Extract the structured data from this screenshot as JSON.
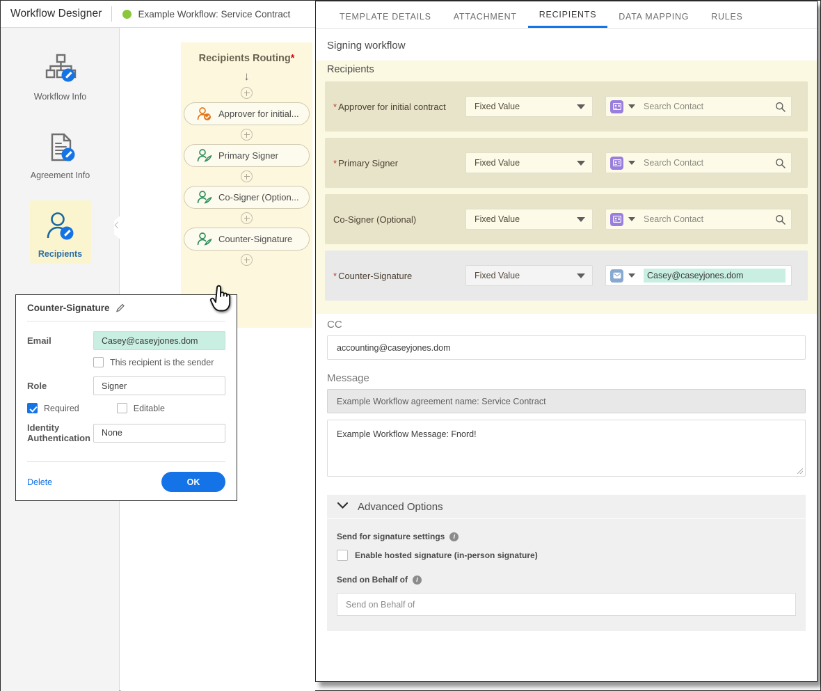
{
  "topbar": {
    "app_title": "Workflow Designer",
    "workflow_name": "Example Workflow: Service Contract",
    "status_color": "#8cc63e"
  },
  "sidebar": {
    "items": [
      {
        "label": "Workflow Info",
        "icon": "workflow-info-icon",
        "active": false
      },
      {
        "label": "Agreement Info",
        "icon": "agreement-info-icon",
        "active": false
      },
      {
        "label": "Recipients",
        "icon": "recipients-icon",
        "active": true
      },
      {
        "label": "",
        "icon": "documents-icon",
        "active": false
      }
    ]
  },
  "canvas": {
    "routing_title": "Recipients Routing",
    "routing_required_marker": "*",
    "nodes": [
      {
        "label": "Approver for initial...",
        "icon": "approver-icon",
        "color": "#e2761b"
      },
      {
        "label": "Primary Signer",
        "icon": "signer-icon",
        "color": "#2f8f5b"
      },
      {
        "label": "Co-Signer (Option...",
        "icon": "signer-icon",
        "color": "#2f8f5b"
      },
      {
        "label": "Counter-Signature",
        "icon": "signer-icon",
        "color": "#2f8f5b"
      }
    ]
  },
  "popup": {
    "title": "Counter-Signature",
    "edit_icon": "pencil-icon",
    "email_label": "Email",
    "email_value": "Casey@caseyjones.dom",
    "sender_checkbox_label": "This recipient is the sender",
    "sender_checked": false,
    "role_label": "Role",
    "role_value": "Signer",
    "required_label": "Required",
    "required_checked": true,
    "editable_label": "Editable",
    "editable_checked": false,
    "identity_label": "Identity Authentication",
    "identity_value": "None",
    "delete_label": "Delete",
    "ok_label": "OK",
    "accent_color": "#1473e6"
  },
  "right_panel": {
    "tabs": [
      {
        "label": "TEMPLATE DETAILS",
        "active": false
      },
      {
        "label": "ATTACHMENT",
        "active": false
      },
      {
        "label": "RECIPIENTS",
        "active": true
      },
      {
        "label": "DATA MAPPING",
        "active": false
      },
      {
        "label": "RULES",
        "active": false
      }
    ],
    "signing_workflow_label": "Signing workflow",
    "recipients_header": "Recipients",
    "recipient_rows": [
      {
        "label": "Approver for initial contract",
        "required": true,
        "value_type": "Fixed Value",
        "contact_icon": "contact-card-icon",
        "contact_placeholder": "Search Contact",
        "contact_value": "",
        "style": "khaki"
      },
      {
        "label": "Primary Signer",
        "required": true,
        "value_type": "Fixed Value",
        "contact_icon": "contact-card-icon",
        "contact_placeholder": "Search Contact",
        "contact_value": "",
        "style": "khaki"
      },
      {
        "label": "Co-Signer (Optional)",
        "required": false,
        "value_type": "Fixed Value",
        "contact_icon": "contact-card-icon",
        "contact_placeholder": "Search Contact",
        "contact_value": "",
        "style": "khaki"
      },
      {
        "label": "Counter-Signature",
        "required": true,
        "value_type": "Fixed Value",
        "contact_icon": "mail-icon",
        "contact_placeholder": "",
        "contact_value": "Casey@caseyjones.dom",
        "style": "gray"
      }
    ],
    "cc_label": "CC",
    "cc_value": "accounting@caseyjones.dom",
    "message_label": "Message",
    "message_subject": "Example Workflow agreement name: Service Contract",
    "message_body": "Example Workflow Message: Fnord!",
    "advanced_options_label": "Advanced Options",
    "send_settings_label": "Send for signature settings",
    "hosted_signature_label": "Enable hosted signature (in-person signature)",
    "hosted_signature_checked": false,
    "send_on_behalf_label": "Send on Behalf of",
    "send_on_behalf_placeholder": "Send on Behalf of",
    "info_glyph": "i"
  }
}
